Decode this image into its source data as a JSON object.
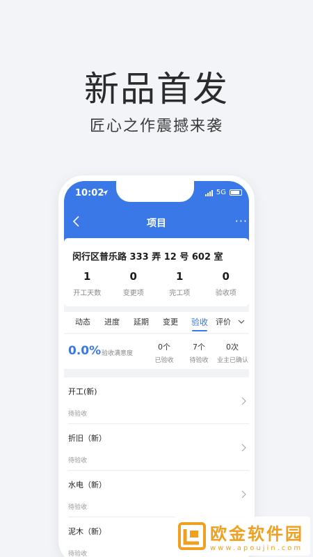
{
  "promo": {
    "headline": "新品首发",
    "subline": "匠心之作震撼来袭"
  },
  "status_bar": {
    "time": "10:02",
    "network": "5G"
  },
  "nav": {
    "title": "项目",
    "more": "···"
  },
  "project": {
    "address": "闵行区普乐路 333 弄 12 号 602 室",
    "stats": [
      {
        "value": "1",
        "label": "开工天数"
      },
      {
        "value": "0",
        "label": "变更项"
      },
      {
        "value": "1",
        "label": "完工项"
      },
      {
        "value": "0",
        "label": "验收项"
      }
    ]
  },
  "tabs": [
    {
      "label": "动态"
    },
    {
      "label": "进度"
    },
    {
      "label": "延期"
    },
    {
      "label": "变更"
    },
    {
      "label": "验收"
    },
    {
      "label": "评价"
    }
  ],
  "active_tab": "验收",
  "summary": {
    "percent": "0.0%",
    "percent_label": "验收满意度",
    "cols": [
      {
        "value": "0个",
        "label": "已验收"
      },
      {
        "value": "7个",
        "label": "待验收"
      },
      {
        "value": "0次",
        "label": "业主已确认"
      }
    ]
  },
  "items": [
    {
      "title": "开工(新)",
      "status": "待验收"
    },
    {
      "title": "折旧（新）",
      "status": "待验收"
    },
    {
      "title": "水电（新）",
      "status": "待验收"
    },
    {
      "title": "泥木（新）",
      "status": "待验收"
    }
  ],
  "watermark": {
    "name": "欧金软件园",
    "url": "www.apoujin.com"
  },
  "colors": {
    "accent": "#3a78e8",
    "background": "#f3f4f8",
    "watermark": "#f0a020"
  }
}
